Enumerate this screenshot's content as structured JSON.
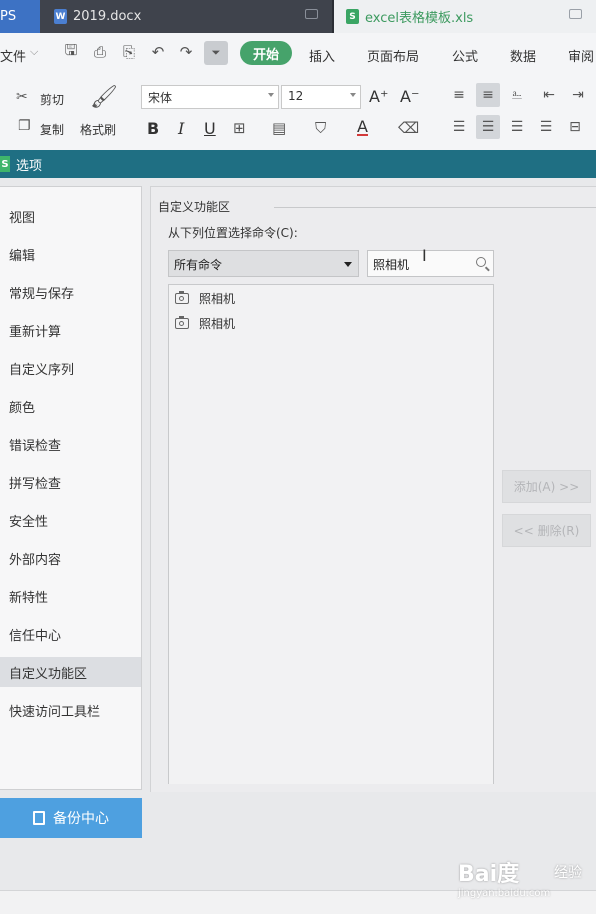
{
  "tabs": [
    {
      "label": "PS",
      "kind": "wps"
    },
    {
      "label": "2019.docx",
      "icon": "word-icon"
    },
    {
      "label": "excel表格模板.xls",
      "icon": "sheet-icon"
    }
  ],
  "menu": {
    "file": "文件",
    "start": "开始",
    "insert": "插入",
    "page_layout": "页面布局",
    "formula": "公式",
    "data": "数据",
    "review": "审阅"
  },
  "ribbon": {
    "cut": "剪切",
    "copy": "复制",
    "format_painter": "格式刷",
    "font_name": "宋体",
    "font_size": "12",
    "bold": "B",
    "italic": "I",
    "underline": "U",
    "grow_font": "A⁺",
    "shrink_font": "A⁻"
  },
  "dialog": {
    "title": "选项",
    "nav_items": [
      "视图",
      "编辑",
      "常规与保存",
      "重新计算",
      "自定义序列",
      "颜色",
      "错误检查",
      "拼写检查",
      "安全性",
      "外部内容",
      "新特性",
      "信任中心",
      "自定义功能区",
      "快速访问工具栏"
    ],
    "selected_nav": "自定义功能区",
    "backup_center": "备份中心",
    "group_title": "自定义功能区",
    "choose_label": "从下列位置选择命令(C):",
    "command_source": "所有命令",
    "search_value": "照相机",
    "list_items": [
      "照相机",
      "照相机"
    ],
    "add_button": "添加(A) >>",
    "remove_button": "<< 删除(R)"
  },
  "watermark": {
    "brand": "Bai度",
    "sub": "经验",
    "url": "jingyan.baidu.com"
  },
  "colors": {
    "accent_green": "#46a36b",
    "dialog_title": "#1f6f83",
    "backup_blue": "#4ea0e0"
  }
}
